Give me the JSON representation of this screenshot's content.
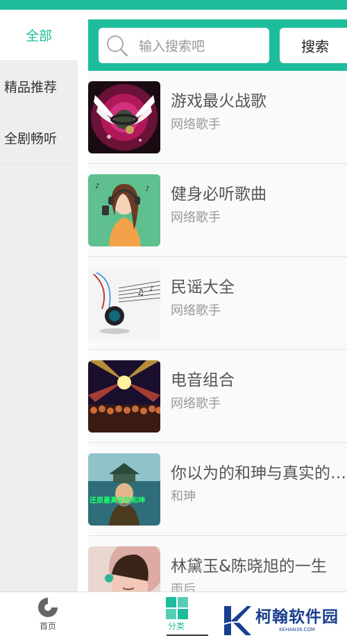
{
  "sidebar": {
    "items": [
      {
        "label": "全部"
      },
      {
        "label": "精品推荐"
      },
      {
        "label": "全剧畅听"
      }
    ]
  },
  "search": {
    "placeholder": "输入搜索吧",
    "button_label": "搜索"
  },
  "list": [
    {
      "title": "游戏最火战歌",
      "subtitle": "网络歌手"
    },
    {
      "title": "健身必听歌曲",
      "subtitle": "网络歌手"
    },
    {
      "title": "民谣大全",
      "subtitle": "网络歌手"
    },
    {
      "title": "电音组合",
      "subtitle": "网络歌手"
    },
    {
      "title": "你以为的和珅与真实的…",
      "subtitle": "和珅",
      "cover_text": "还原最真实的和珅"
    },
    {
      "title": "林黛玉&陈晓旭的一生",
      "subtitle": "雨后"
    }
  ],
  "bottom_nav": {
    "tabs": [
      {
        "label": "首页",
        "icon": "home-disc-icon"
      },
      {
        "label": "分类",
        "icon": "category-grid-icon"
      }
    ]
  },
  "watermark": {
    "name": "柯翰软件园",
    "url": "KEHAN38.COM"
  },
  "colors": {
    "accent": "#1dbd9c",
    "watermark": "#1a3f8f"
  }
}
